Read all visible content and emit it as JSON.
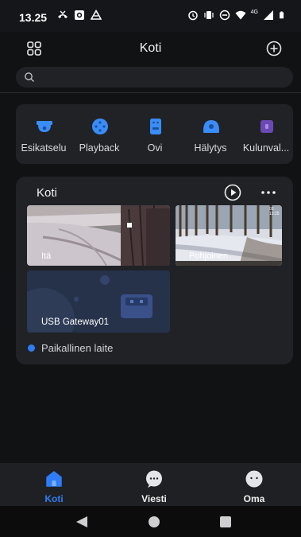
{
  "status_bar": {
    "time": "13.25",
    "network_label": "4G",
    "icons": [
      "missed-call-icon",
      "photo-icon",
      "drive-icon",
      "alarm-icon",
      "vibrate-icon",
      "do-not-disturb-icon",
      "wifi-icon",
      "signal-icon",
      "battery-icon"
    ]
  },
  "header": {
    "title": "Koti"
  },
  "search": {
    "placeholder": "",
    "value": ""
  },
  "shortcuts": [
    {
      "label": "Esikatselu",
      "icon": "camera-dome-icon"
    },
    {
      "label": "Playback",
      "icon": "playback-icon"
    },
    {
      "label": "Ovi",
      "icon": "door-icon"
    },
    {
      "label": "Hälytys",
      "icon": "alarm-eye-icon"
    },
    {
      "label": "Kulunval...",
      "icon": "access-control-icon"
    }
  ],
  "home_card": {
    "title": "Koti",
    "cameras": [
      {
        "label": "Itä"
      },
      {
        "label": "Pohjoinen",
        "overlay_time": "03 13:25"
      },
      {
        "label": "USB Gateway01"
      }
    ],
    "status_label": "Paikallinen laite"
  },
  "bottom_nav": [
    {
      "label": "Koti",
      "active": true
    },
    {
      "label": "Viesti",
      "active": false
    },
    {
      "label": "Oma",
      "active": false
    }
  ],
  "colors": {
    "accent": "#2f7df6",
    "background": "#111214",
    "card": "#202226"
  }
}
